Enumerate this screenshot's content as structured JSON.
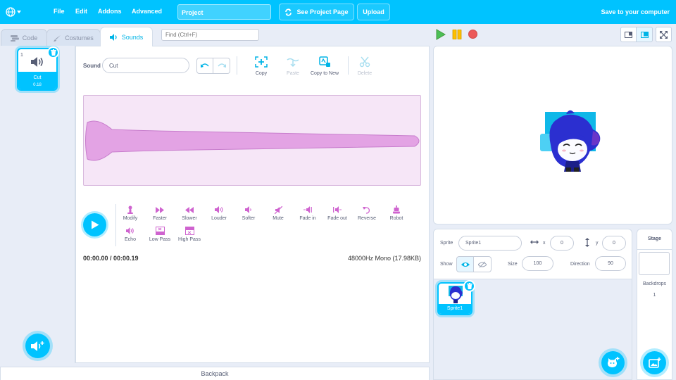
{
  "menubar": {
    "file": "File",
    "edit": "Edit",
    "addons": "Addons",
    "advanced": "Advanced",
    "project_title": "Project",
    "see_project_page": "See Project Page",
    "upload": "Upload",
    "save": "Save to your computer"
  },
  "tabs": [
    {
      "label": "Code",
      "icon": "code-icon"
    },
    {
      "label": "Costumes",
      "icon": "brush-icon"
    },
    {
      "label": "Sounds",
      "icon": "speaker-icon"
    }
  ],
  "find": {
    "placeholder": "Find (Ctrl+F)"
  },
  "sounds": [
    {
      "index": "1",
      "name": "Cut",
      "duration": "0.18"
    }
  ],
  "editor": {
    "sound_label": "Sound",
    "sound_name": "Cut",
    "tools": [
      {
        "label": "Copy",
        "icon": "copy-icon",
        "disabled": false
      },
      {
        "label": "Paste",
        "icon": "paste-icon",
        "disabled": true
      },
      {
        "label": "Copy to New",
        "icon": "copy-to-new-icon",
        "disabled": false
      },
      {
        "label": "Delete",
        "icon": "scissors-icon",
        "disabled": true
      }
    ],
    "effects": [
      {
        "label": "Modify",
        "icon": "modify-icon"
      },
      {
        "label": "Faster",
        "icon": "faster-icon"
      },
      {
        "label": "Slower",
        "icon": "slower-icon"
      },
      {
        "label": "Louder",
        "icon": "louder-icon"
      },
      {
        "label": "Softer",
        "icon": "softer-icon"
      },
      {
        "label": "Mute",
        "icon": "mute-icon"
      },
      {
        "label": "Fade in",
        "icon": "fade-in-icon"
      },
      {
        "label": "Fade out",
        "icon": "fade-out-icon"
      },
      {
        "label": "Reverse",
        "icon": "reverse-icon"
      },
      {
        "label": "Robot",
        "icon": "robot-icon"
      },
      {
        "label": "Echo",
        "icon": "echo-icon"
      },
      {
        "label": "Low Pass",
        "icon": "low-pass-icon"
      },
      {
        "label": "High Pass",
        "icon": "high-pass-icon"
      }
    ],
    "time": "00:00.00 / 00:00.19",
    "format": "48000Hz Mono (17.98KB)"
  },
  "backpack": "Backpack",
  "sprite_info": {
    "sprite_label": "Sprite",
    "sprite_name": "Sprite1",
    "x_label": "x",
    "x_value": "0",
    "y_label": "y",
    "y_value": "0",
    "show_label": "Show",
    "size_label": "Size",
    "size_value": "100",
    "direction_label": "Direction",
    "direction_value": "90"
  },
  "sprites": [
    {
      "name": "Sprite1"
    }
  ],
  "stage_pane": {
    "title": "Stage",
    "backdrops_label": "Backdrops",
    "backdrops_count": "1"
  },
  "colors": {
    "accent": "#00c3ff",
    "waveform_fill": "#e3a3e4",
    "effect_icon": "#cf63cf"
  }
}
